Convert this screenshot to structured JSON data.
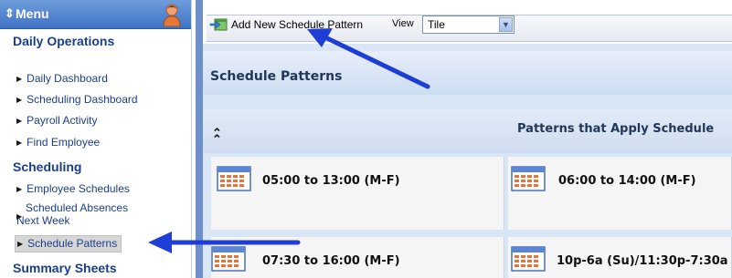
{
  "sidebar": {
    "menu_glyph": "⇕",
    "menu_title": "Menu",
    "sections": [
      {
        "title": "Daily Operations",
        "items": [
          "Daily Dashboard",
          "Scheduling Dashboard",
          "Payroll Activity",
          "Find Employee"
        ]
      },
      {
        "title": "Scheduling",
        "items": [
          "Employee Schedules",
          "Scheduled Absences",
          "Next Week",
          "Schedule Patterns"
        ]
      },
      {
        "title": "Summary Sheets",
        "items": []
      }
    ]
  },
  "toolbar": {
    "add_label": "Add New Schedule Pattern",
    "view_label": "View",
    "view_selected": "Tile"
  },
  "main": {
    "section_title": "Schedule Patterns",
    "collapse_glyph": "☆",
    "group_title": "Patterns that Apply Schedule",
    "tiles": [
      "05:00 to 13:00 (M-F)",
      "06:00 to 14:00 (M-F)",
      "07:30 to 16:00 (M-F)",
      "10p-6a (Su)/11:30p-7:30a"
    ]
  },
  "colors": {
    "nav_text": "#1a3f8a",
    "header_blue": "#3f72c4",
    "arrow_blue": "#1f3ed6"
  },
  "icons": {
    "user": "user-avatar-icon",
    "add": "add-pattern-icon",
    "calendar": "calendar-icon",
    "collapse": "collapse-icon",
    "dropdown": "chevron-down-icon"
  }
}
